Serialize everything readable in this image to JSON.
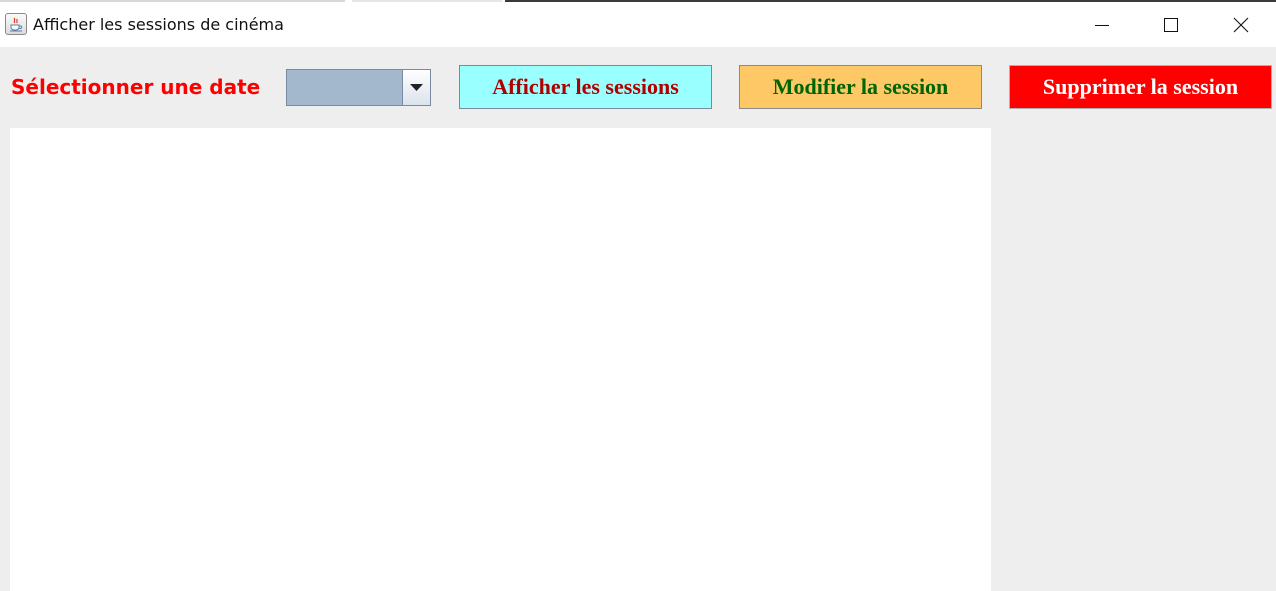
{
  "window": {
    "title": "Afficher les sessions de cinéma",
    "app_icon": "java-cup-icon",
    "controls": [
      "minimize-icon",
      "maximize-icon",
      "close-icon"
    ]
  },
  "toolbar": {
    "date_label": "Sélectionner une date",
    "date_combo": {
      "selected_value": ""
    },
    "buttons": {
      "show_sessions": "Afficher les sessions",
      "edit_session": "Modifier la session",
      "delete_session": "Supprimer la session"
    }
  },
  "colors": {
    "date_label": "#ff0000",
    "show_sessions_bg": "#99ffff",
    "show_sessions_text": "#b00000",
    "edit_session_bg": "#ffc866",
    "edit_session_text": "#006400",
    "delete_session_bg": "#ff0000",
    "delete_session_text": "#ffffff",
    "combo_bg": "#a3b8cc"
  },
  "sessions_panel": {
    "rows": []
  }
}
